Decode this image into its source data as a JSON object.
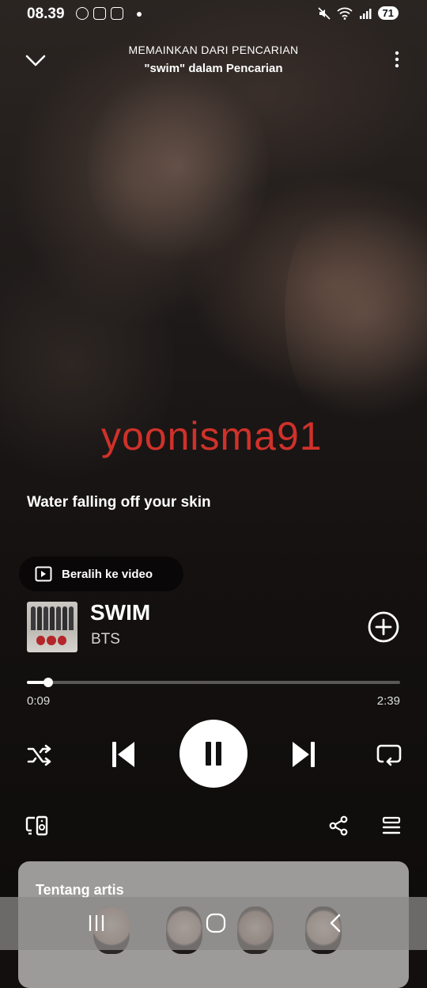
{
  "status_bar": {
    "time": "08.39",
    "battery": "71"
  },
  "header": {
    "context_label": "MEMAINKAN DARI PENCARIAN",
    "context_source": "\"swim\" dalam Pencarian"
  },
  "watermark": "yoonisma91",
  "lyric_line": "Water falling off your skin",
  "switch_video_label": "Beralih ke video",
  "track": {
    "title": "SWIM",
    "artist": "BTS"
  },
  "playback": {
    "elapsed": "0:09",
    "total": "2:39",
    "progress_fraction": 0.057
  },
  "about_artist": {
    "title": "Tentang artis"
  },
  "colors": {
    "watermark": "#d0312a",
    "background": "#141110",
    "sheet": "#9d9b99"
  },
  "icons": [
    "collapse-chevron-icon",
    "more-options-icon",
    "video-icon",
    "add-circle-icon",
    "shuffle-icon",
    "previous-icon",
    "pause-icon",
    "next-icon",
    "repeat-icon",
    "connect-device-icon",
    "share-icon",
    "queue-icon"
  ]
}
